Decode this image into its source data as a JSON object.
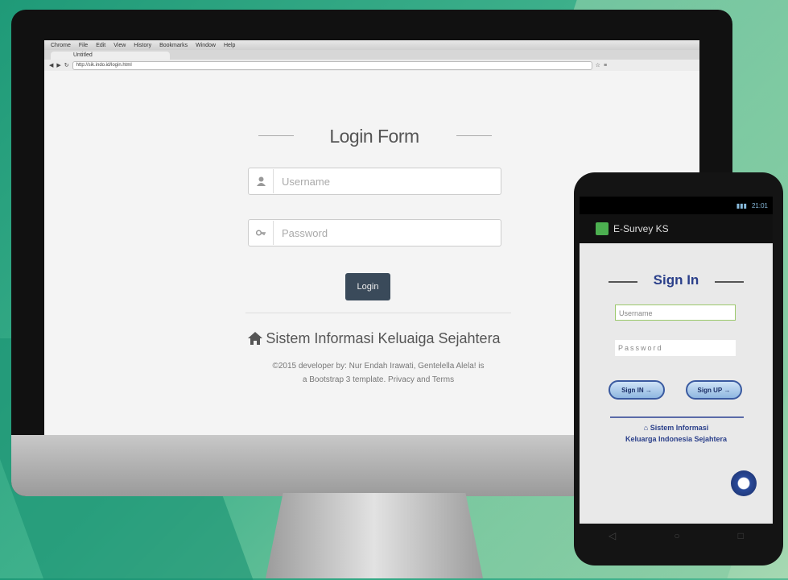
{
  "browser": {
    "menu": [
      "Chrome",
      "File",
      "Edit",
      "View",
      "History",
      "Bookmarks",
      "Window",
      "Help"
    ],
    "tab_label": "Untitled",
    "address": "http://sik.indo.id/login.html"
  },
  "login": {
    "title": "Login Form",
    "username_placeholder": "Username",
    "password_placeholder": "Password",
    "login_button": "Login",
    "brand": "Sistem Informasi Keluaiga Sejahtera",
    "footer_line1": "©2015 developer by: Nur Endah Irawati, Gentelella Alela! is",
    "footer_line2": "a Bootstrap 3 template. Privacy and Terms"
  },
  "phone": {
    "app_title": "E-Survey KS",
    "status": "21:01",
    "sign_in": "Sign In",
    "username_placeholder": "Username",
    "password_placeholder": "Password",
    "button_left": "Sign IN",
    "button_right": "Sign UP",
    "brand_line1": "Sistem Informasi",
    "brand_line2": "Keluarga Indonesia Sejahtera"
  },
  "colors": {
    "background": "#3fb18c",
    "login_button": "#3a4a5a",
    "phone_accent": "#2a3f8a"
  }
}
